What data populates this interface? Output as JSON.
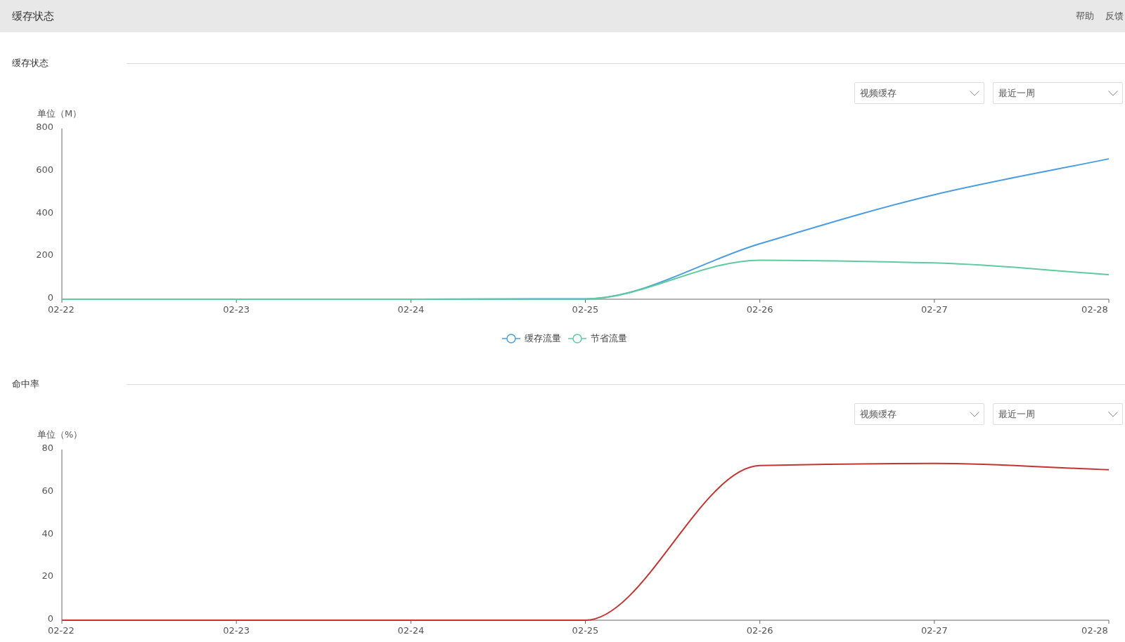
{
  "header": {
    "title": "缓存状态",
    "links": [
      "帮助",
      "反馈"
    ]
  },
  "sections": [
    {
      "title": "缓存状态",
      "dropdowns": [
        "视频缓存",
        "最近一周"
      ],
      "chart_data": {
        "type": "line",
        "ylabel": "单位（M）",
        "categories": [
          "02-22",
          "02-23",
          "02-24",
          "02-25",
          "02-26",
          "02-27",
          "02-28"
        ],
        "ylim": [
          0,
          800
        ],
        "yticks": [
          0,
          200,
          400,
          600,
          800
        ],
        "series": [
          {
            "name": "缓存流量",
            "color": "#4a9de0",
            "values": [
              0,
              0,
              0,
              2,
              260,
              490,
              658
            ]
          },
          {
            "name": "节省流量",
            "color": "#5fc9a0",
            "values": [
              0,
              0,
              0,
              1,
              183,
              170,
              115
            ]
          }
        ]
      }
    },
    {
      "title": "命中率",
      "dropdowns": [
        "视频缓存",
        "最近一周"
      ],
      "chart_data": {
        "type": "line",
        "ylabel": "单位（%）",
        "categories": [
          "02-22",
          "02-23",
          "02-24",
          "02-25",
          "02-26",
          "02-27",
          "02-28"
        ],
        "ylim": [
          0,
          80
        ],
        "yticks": [
          0,
          20,
          40,
          60,
          80
        ],
        "series": [
          {
            "color": "#c23531",
            "values": [
              0,
              0,
              0,
              0,
              72.5,
              73.5,
              70.5
            ]
          }
        ]
      }
    }
  ]
}
